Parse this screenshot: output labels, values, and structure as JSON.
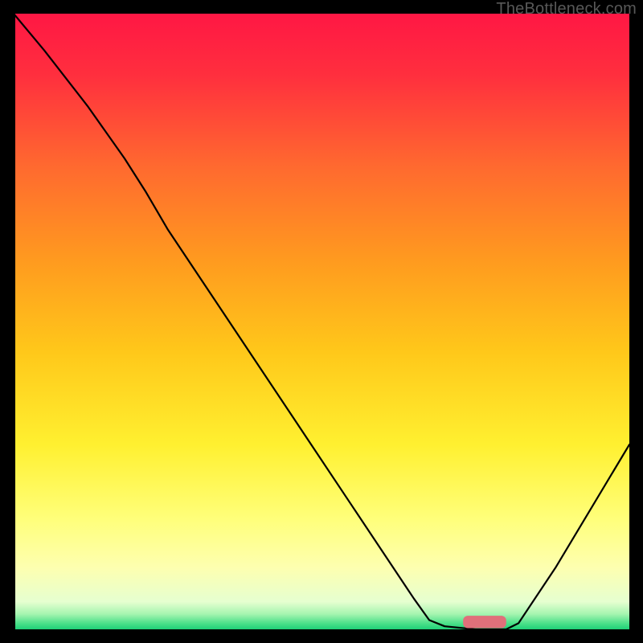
{
  "watermark": "TheBottleneck.com",
  "chart_data": {
    "type": "line",
    "title": "",
    "xlabel": "",
    "ylabel": "",
    "xlim": [
      0,
      100
    ],
    "ylim": [
      0,
      100
    ],
    "background": {
      "type": "vertical-gradient",
      "stops": [
        {
          "pos": 0.0,
          "color": "#ff1744"
        },
        {
          "pos": 0.1,
          "color": "#ff2f3e"
        },
        {
          "pos": 0.25,
          "color": "#ff6a2f"
        },
        {
          "pos": 0.4,
          "color": "#ff9a1f"
        },
        {
          "pos": 0.55,
          "color": "#ffc81a"
        },
        {
          "pos": 0.7,
          "color": "#fff030"
        },
        {
          "pos": 0.82,
          "color": "#ffff7a"
        },
        {
          "pos": 0.9,
          "color": "#fdffb0"
        },
        {
          "pos": 0.955,
          "color": "#e6ffd0"
        },
        {
          "pos": 0.975,
          "color": "#a6f5b0"
        },
        {
          "pos": 0.99,
          "color": "#4de08a"
        },
        {
          "pos": 1.0,
          "color": "#1fd077"
        }
      ]
    },
    "series": [
      {
        "name": "bottleneck-curve",
        "color": "#000000",
        "points": [
          {
            "x": 0.0,
            "y": 100.0
          },
          {
            "x": 5.0,
            "y": 94.0
          },
          {
            "x": 12.0,
            "y": 85.0
          },
          {
            "x": 18.0,
            "y": 76.5
          },
          {
            "x": 21.5,
            "y": 71.0
          },
          {
            "x": 25.0,
            "y": 65.0
          },
          {
            "x": 35.0,
            "y": 50.0
          },
          {
            "x": 45.0,
            "y": 35.0
          },
          {
            "x": 55.0,
            "y": 20.0
          },
          {
            "x": 65.0,
            "y": 5.0
          },
          {
            "x": 67.5,
            "y": 1.5
          },
          {
            "x": 70.0,
            "y": 0.5
          },
          {
            "x": 75.0,
            "y": 0.0
          },
          {
            "x": 80.0,
            "y": 0.0
          },
          {
            "x": 82.0,
            "y": 1.0
          },
          {
            "x": 88.0,
            "y": 10.0
          },
          {
            "x": 94.0,
            "y": 20.0
          },
          {
            "x": 100.0,
            "y": 30.0
          }
        ]
      }
    ],
    "marker": {
      "type": "capsule",
      "color": "#e0707a",
      "x_start": 73.0,
      "x_end": 80.0,
      "y": 1.2,
      "height": 2.0
    }
  }
}
